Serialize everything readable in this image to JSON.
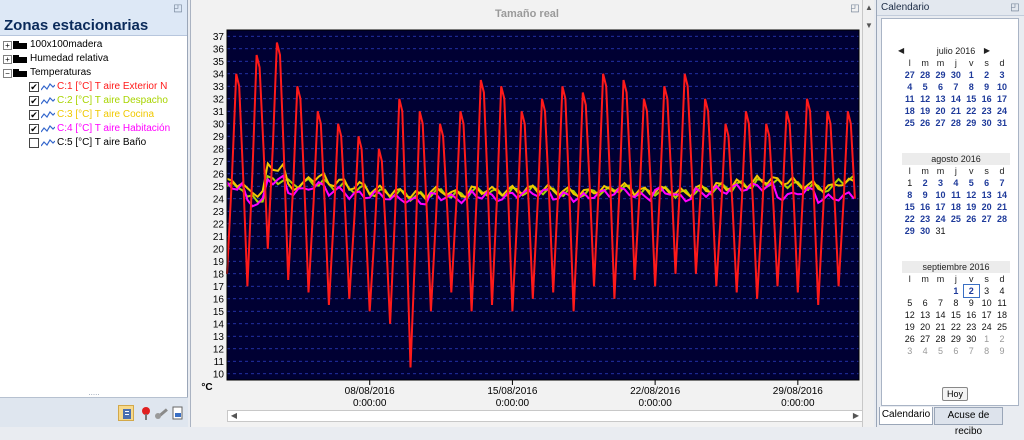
{
  "left_panel": {
    "title": "Zonas estacionarias",
    "tree": [
      {
        "label": "100x100madera"
      },
      {
        "label": "Humedad relativa"
      },
      {
        "label": "Temperaturas"
      }
    ],
    "channels": [
      {
        "label": "C:1 [°C] T aire Exterior N",
        "checked": true,
        "color": "#ff1a1a"
      },
      {
        "label": "C:2 [°C] T aire Despacho",
        "checked": true,
        "color": "#a8d400"
      },
      {
        "label": "C:3 [°C] T aire Cocina",
        "checked": true,
        "color": "#f0c800"
      },
      {
        "label": "C:4 [°C] T aire Habitación",
        "checked": true,
        "color": "#ff00ff"
      },
      {
        "label": "C:5 [°C] T aire Baño",
        "checked": false,
        "color": "#000000"
      }
    ],
    "grip": "....."
  },
  "chart": {
    "header": "Tamaño real"
  },
  "chart_data": {
    "type": "line",
    "x_type": "date",
    "xlim": [
      "2016-08-01",
      "2016-09-01"
    ],
    "ylim": [
      9.5,
      37.5
    ],
    "ylabel": "°C",
    "yticks": [
      10,
      11,
      12,
      13,
      14,
      15,
      16,
      17,
      18,
      19,
      20,
      21,
      22,
      23,
      24,
      25,
      26,
      27,
      28,
      29,
      30,
      31,
      32,
      33,
      34,
      35,
      36,
      37
    ],
    "xticks": [
      {
        "date": "08/08/2016",
        "time": "0:00:00"
      },
      {
        "date": "15/08/2016",
        "time": "0:00:00"
      },
      {
        "date": "22/08/2016",
        "time": "0:00:00"
      },
      {
        "date": "29/08/2016",
        "time": "0:00:00"
      }
    ],
    "grid": true,
    "background": "#000033",
    "series": [
      {
        "name": "C:1 [°C] T aire Exterior N",
        "color": "#ff1a1a",
        "daily_max": [
          34,
          35.5,
          36.5,
          33,
          31,
          30,
          29,
          28,
          32,
          31,
          30,
          31,
          33.5,
          33,
          31,
          32,
          33,
          32.5,
          34,
          33.5,
          32,
          33,
          34,
          32,
          30,
          31,
          30,
          31,
          32,
          31,
          31
        ],
        "daily_min": [
          18,
          17,
          20,
          17.5,
          16.5,
          15.5,
          16,
          15,
          14,
          10.5,
          15,
          16.5,
          15,
          15.5,
          15,
          16,
          16.5,
          15,
          17,
          16,
          17.5,
          17,
          18,
          18,
          17,
          16.5,
          16,
          17,
          16.5,
          15.5,
          17
        ]
      },
      {
        "name": "C:2 [°C] T aire Despacho",
        "color": "#a8d400",
        "values": [
          25,
          24,
          25.5,
          25.2,
          25.3,
          25,
          24.8,
          24.5,
          24.4,
          24.2,
          24.5,
          24.3,
          24.6,
          24.5,
          24.6,
          24.7,
          24.5,
          24.4,
          24.6,
          24.8,
          24.5,
          24.6,
          24.4,
          24.7,
          24.9,
          25.1,
          25.3,
          25.2,
          25,
          24.8,
          25.5
        ]
      },
      {
        "name": "C:3 [°C] T aire Cocina",
        "color": "#f0c800",
        "values": [
          25.3,
          24.5,
          26.5,
          25,
          25.7,
          25.3,
          25,
          24.7,
          24.5,
          24.3,
          24.6,
          24.4,
          24.7,
          24.6,
          24.7,
          24.8,
          24.6,
          24.5,
          24.7,
          24.9,
          24.6,
          24.7,
          24.5,
          24.8,
          25,
          25.2,
          25.5,
          25.4,
          25.1,
          24.9,
          25.3
        ]
      },
      {
        "name": "C:4 [°C] T aire Habitación",
        "color": "#ff00ff",
        "values": [
          25,
          23.7,
          25.5,
          24.6,
          25,
          24.6,
          24.3,
          24.3,
          24,
          23.8,
          24.2,
          24,
          24.3,
          24.1,
          24.4,
          24.5,
          24.2,
          24.1,
          24.4,
          24.6,
          24.2,
          24.6,
          24.1,
          24.5,
          24.7,
          24.9,
          25,
          24.2,
          24.6,
          24,
          24.2
        ]
      }
    ]
  },
  "calendar": {
    "title": "Calendario",
    "dow": [
      "l",
      "m",
      "m",
      "j",
      "v",
      "s",
      "d"
    ],
    "months": [
      {
        "name": "julio 2016",
        "weeks": [
          [
            "27",
            "28",
            "29",
            "30",
            "1",
            "2",
            "3"
          ],
          [
            "4",
            "5",
            "6",
            "7",
            "8",
            "9",
            "10"
          ],
          [
            "11",
            "12",
            "13",
            "14",
            "15",
            "16",
            "17"
          ],
          [
            "18",
            "19",
            "20",
            "21",
            "22",
            "23",
            "24"
          ],
          [
            "25",
            "26",
            "27",
            "28",
            "29",
            "30",
            "31"
          ]
        ]
      },
      {
        "name": "agosto 2016",
        "weeks": [
          [
            "1",
            "2",
            "3",
            "4",
            "5",
            "6",
            "7"
          ],
          [
            "8",
            "9",
            "10",
            "11",
            "12",
            "13",
            "14"
          ],
          [
            "15",
            "16",
            "17",
            "18",
            "19",
            "20",
            "21"
          ],
          [
            "22",
            "23",
            "24",
            "25",
            "26",
            "27",
            "28"
          ],
          [
            "29",
            "30",
            "31",
            "",
            "",
            "",
            ""
          ]
        ]
      },
      {
        "name": "septiembre 2016",
        "weeks": [
          [
            "",
            "",
            "",
            "1",
            "2",
            "3",
            "4"
          ],
          [
            "5",
            "6",
            "7",
            "8",
            "9",
            "10",
            "11"
          ],
          [
            "12",
            "13",
            "14",
            "15",
            "16",
            "17",
            "18"
          ],
          [
            "19",
            "20",
            "21",
            "22",
            "23",
            "24",
            "25"
          ],
          [
            "26",
            "27",
            "28",
            "29",
            "30",
            "1",
            "2"
          ],
          [
            "3",
            "4",
            "5",
            "6",
            "7",
            "8",
            "9"
          ]
        ]
      }
    ],
    "today_button": "Hoy",
    "tabs": [
      "Calendario",
      "Acuse de recibo"
    ]
  }
}
